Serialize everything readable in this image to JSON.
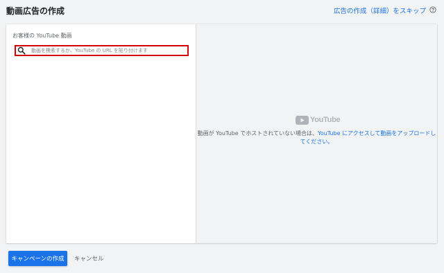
{
  "header": {
    "title": "動画広告の作成",
    "skip_link": "広告の作成（詳細）をスキップ",
    "help_icon": "help-circle-icon"
  },
  "left_panel": {
    "section_label": "お客様の YouTube 動画",
    "search": {
      "icon": "search-icon",
      "placeholder": "動画を検索するか、YouTube の URL を貼り付けます",
      "value": ""
    }
  },
  "right_panel": {
    "logo_text": "YouTube",
    "info_prefix": "動画が YouTube でホストされていない場合は、",
    "info_link": "YouTube にアクセスして動画をアップロードしてください。"
  },
  "footer": {
    "create_campaign_label": "キャンペーンの作成",
    "cancel_label": "キャンセル"
  },
  "colors": {
    "accent": "#1a73e8",
    "highlight_border": "#d50000",
    "background": "#f1f3f4"
  }
}
